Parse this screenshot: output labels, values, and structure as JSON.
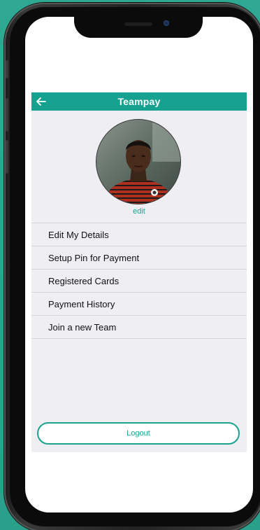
{
  "header": {
    "title": "Teampay",
    "back_icon": "arrow-left-icon"
  },
  "profile": {
    "edit_label": "edit"
  },
  "menu": {
    "items": [
      {
        "label": "Edit My Details"
      },
      {
        "label": "Setup Pin for Payment"
      },
      {
        "label": "Registered Cards"
      },
      {
        "label": "Payment History"
      },
      {
        "label": "Join a new Team"
      }
    ]
  },
  "footer": {
    "logout_label": "Logout"
  },
  "colors": {
    "accent": "#17a190",
    "background": "#2fa58f",
    "surface": "#eeeef3"
  }
}
